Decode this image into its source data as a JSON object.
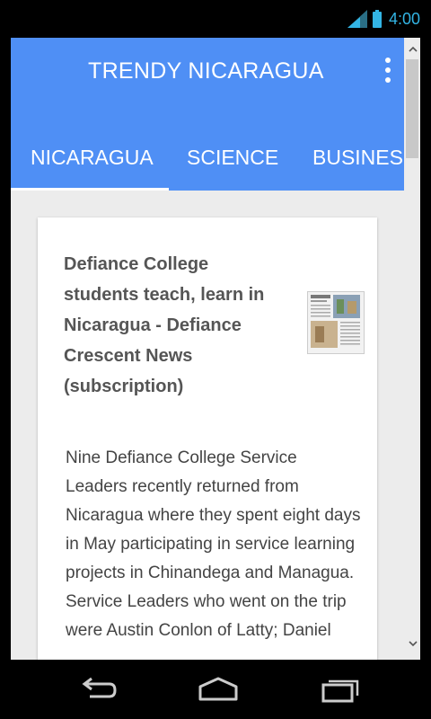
{
  "status_bar": {
    "time": "4:00",
    "icons": [
      "signal-icon",
      "battery-icon"
    ],
    "accent_color": "#33b5e5"
  },
  "app_bar": {
    "title": "TRENDY NICARAGUA",
    "menu_icon": "overflow-menu-icon",
    "color": "#4f8ff5"
  },
  "tabs": [
    {
      "label": "NICARAGUA",
      "selected": true
    },
    {
      "label": "SCIENCE",
      "selected": false
    },
    {
      "label": "BUSINESS",
      "selected": false
    }
  ],
  "article": {
    "title": "Defiance College students teach, learn in Nicaragua - Defiance Crescent News (subscription)",
    "thumbnail": "newspaper-thumbnail",
    "body": "Nine Defiance College Service Leaders recently returned from Nicaragua where they spent eight days in May participating in service learning projects in Chinandega and Managua. Service Leaders who went on the trip were Austin Conlon of Latty; Daniel"
  },
  "nav_bar": {
    "icons": [
      "back-icon",
      "home-icon",
      "recent-apps-icon"
    ]
  }
}
